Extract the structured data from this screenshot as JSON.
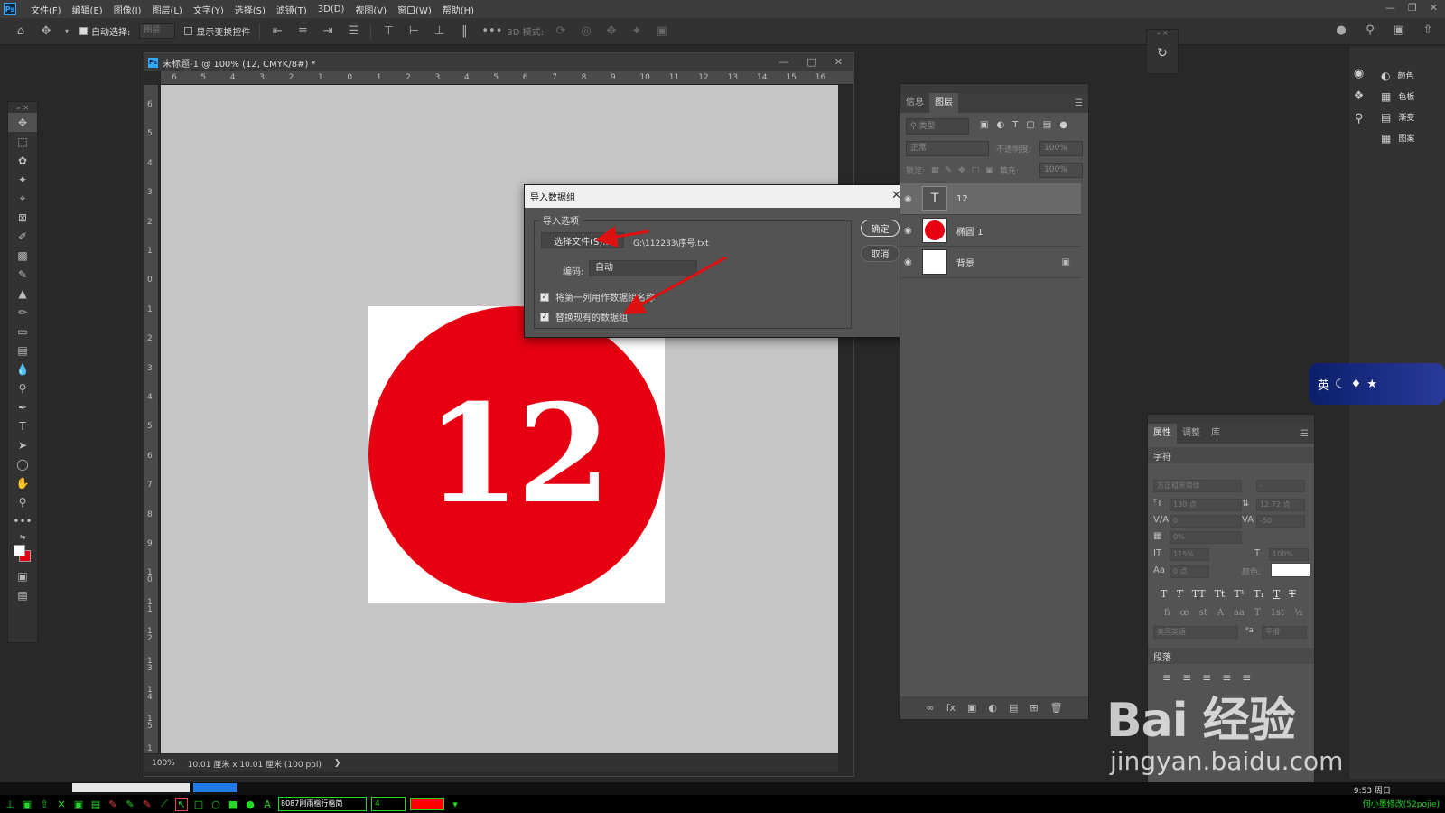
{
  "menubar": {
    "logo": "Ps",
    "items": [
      "文件(F)",
      "编辑(E)",
      "图像(I)",
      "图层(L)",
      "文字(Y)",
      "选择(S)",
      "滤镜(T)",
      "3D(D)",
      "视图(V)",
      "窗口(W)",
      "帮助(H)"
    ]
  },
  "options": {
    "auto_select_label": "自动选择:",
    "auto_select_value": "图层",
    "transform_label": "显示变换控件",
    "mode_3d_label": "3D 模式:"
  },
  "document": {
    "title": "未标题-1 @ 100% (12, CMYK/8#) *",
    "ruler_h": [
      "6",
      "5",
      "4",
      "3",
      "2",
      "1",
      "0",
      "1",
      "2",
      "3",
      "4",
      "5",
      "6",
      "7",
      "8",
      "9",
      "10",
      "11",
      "12",
      "13",
      "14",
      "15",
      "16"
    ],
    "ruler_v": [
      "6",
      "5",
      "4",
      "3",
      "2",
      "1",
      "0",
      "1",
      "2",
      "3",
      "4",
      "5",
      "6",
      "7",
      "8",
      "9",
      "1 0",
      "1 1",
      "1 2",
      "1 3",
      "1 4",
      "1 5",
      "1"
    ],
    "circle_text": "12",
    "circle_color": "#e60012",
    "status_zoom": "100%",
    "status_info": "10.01 厘米 x 10.01 厘米 (100 ppi)"
  },
  "dialog": {
    "title": "导入数据组",
    "group_label": "导入选项",
    "select_file_button": "选择文件(S)...",
    "file_path": "G:\\112233\\序号.txt",
    "encoding_label": "编码:",
    "encoding_value": "自动",
    "checkbox1_label": "将第一列用作数据组名称",
    "checkbox2_label": "替换现有的数据组",
    "ok_button": "确定",
    "cancel_button": "取消"
  },
  "layers_panel": {
    "tabs": [
      "信息",
      "图层"
    ],
    "filter_placeholder": "类型",
    "blend_mode": "正常",
    "opacity_label": "不透明度:",
    "opacity_value": "100%",
    "lock_label": "锁定:",
    "fill_label": "填充:",
    "fill_value": "100%",
    "layers": [
      {
        "name": "12",
        "type": "text"
      },
      {
        "name": "椭圆 1",
        "type": "shape"
      },
      {
        "name": "背景",
        "type": "background"
      }
    ]
  },
  "swatches_panel": {
    "items": [
      {
        "label": "颜色",
        "icon": "color-icon"
      },
      {
        "label": "色板",
        "icon": "swatches-icon"
      },
      {
        "label": "渐变",
        "icon": "gradient-icon"
      },
      {
        "label": "图案",
        "icon": "pattern-icon"
      }
    ]
  },
  "properties_panel": {
    "tabs": [
      "属性",
      "调整",
      "库"
    ],
    "character_header": "字符",
    "font_family": "方正粗宋简体",
    "font_style": "-",
    "font_size": "130 点",
    "leading": "12.72 点",
    "kerning": "0",
    "tracking": "-50",
    "tsume": "0%",
    "vertical_scale": "115%",
    "horizontal_scale": "100%",
    "baseline_shift": "0 点",
    "color_label": "颜色:",
    "text_color": "#ffffff",
    "language": "美国英语",
    "antialias": "平滑",
    "paragraph_header": "段落"
  },
  "ime": {
    "label": "英"
  },
  "taskbar": {
    "font_field": "8087刚雨楷行楷简",
    "size_value": "4",
    "color": "#ff0000",
    "clock": "9:53 周日",
    "credit": "何小墨修改(52pojie)"
  },
  "watermark": {
    "top": "Bai 经验",
    "bottom": "jingyan.baidu.com"
  }
}
